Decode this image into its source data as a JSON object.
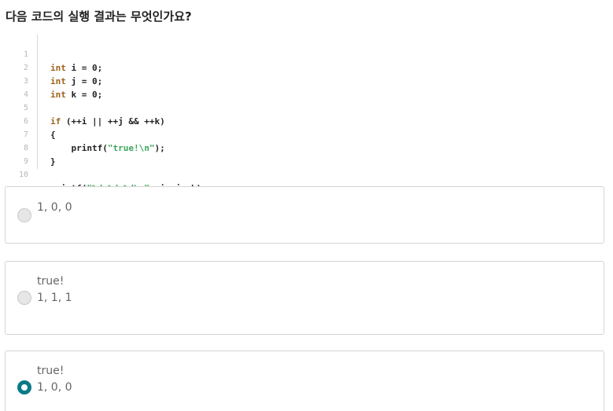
{
  "question": {
    "title": "다음 코드의  실행 결과는 무엇인가요?"
  },
  "code": {
    "lines": [
      {
        "number": "1",
        "segments": [
          {
            "type": "keyword",
            "text": "int"
          },
          {
            "type": "plain",
            "text": " i = 0;"
          }
        ]
      },
      {
        "number": "2",
        "segments": [
          {
            "type": "keyword",
            "text": "int"
          },
          {
            "type": "plain",
            "text": " j = 0;"
          }
        ]
      },
      {
        "number": "3",
        "segments": [
          {
            "type": "keyword",
            "text": "int"
          },
          {
            "type": "plain",
            "text": " k = 0;"
          }
        ]
      },
      {
        "number": "4",
        "segments": []
      },
      {
        "number": "5",
        "segments": [
          {
            "type": "keyword",
            "text": "if"
          },
          {
            "type": "plain",
            "text": " (++i || ++j && ++k)"
          }
        ]
      },
      {
        "number": "6",
        "segments": [
          {
            "type": "plain",
            "text": "{"
          }
        ]
      },
      {
        "number": "7",
        "segments": [
          {
            "type": "plain",
            "text": "    printf("
          },
          {
            "type": "string",
            "text": "\"true!\\n\""
          },
          {
            "type": "plain",
            "text": ");"
          }
        ]
      },
      {
        "number": "8",
        "segments": [
          {
            "type": "plain",
            "text": "}"
          }
        ]
      },
      {
        "number": "9",
        "segments": []
      },
      {
        "number": "10",
        "segments": [
          {
            "type": "plain",
            "text": "printf("
          },
          {
            "type": "string",
            "text": "\"%d %d %d\\n\""
          },
          {
            "type": "plain",
            "text": ", i, j, k);"
          }
        ]
      }
    ]
  },
  "options": [
    {
      "lines": [
        "1, 0, 0"
      ],
      "selected": false
    },
    {
      "lines": [
        "true!",
        "1, 1, 1"
      ],
      "selected": false
    },
    {
      "lines": [
        "true!",
        "1, 0, 0"
      ],
      "selected": true
    }
  ],
  "colors": {
    "keyword": "#a0621b",
    "string": "#3ba55c",
    "selected_radio": "#0b7a87"
  }
}
